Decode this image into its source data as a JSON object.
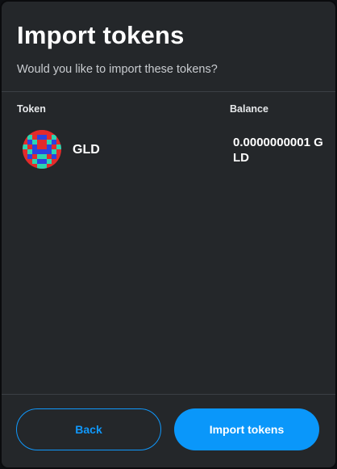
{
  "header": {
    "title": "Import tokens",
    "subtitle": "Would you like to import these tokens?"
  },
  "table": {
    "columns": [
      "Token",
      "Balance"
    ],
    "rows": [
      {
        "symbol": "GLD",
        "balance": "0.0000000001 GLD",
        "icon": "identicon-avatar"
      }
    ]
  },
  "footer": {
    "back_label": "Back",
    "import_label": "Import tokens"
  },
  "colors": {
    "background": "#24272a",
    "accent": "#0a97fa",
    "text": "#ffffff"
  }
}
